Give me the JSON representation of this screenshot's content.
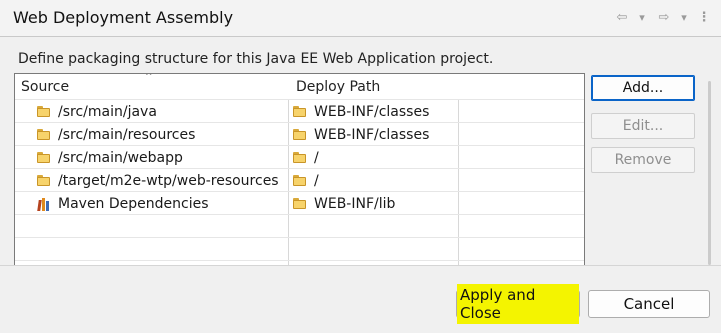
{
  "header": {
    "title": "Web Deployment Assembly",
    "nav": [
      {
        "name": "back-arrow-icon",
        "glyph": "⇦"
      },
      {
        "name": "back-dropdown-icon",
        "glyph": "▾"
      },
      {
        "name": "forward-arrow-icon",
        "glyph": "⇨"
      },
      {
        "name": "forward-dropdown-icon",
        "glyph": "▾"
      },
      {
        "name": "more-options-icon",
        "glyph": "⋮"
      }
    ]
  },
  "main": {
    "description": "Define packaging structure for this Java EE Web Application project.",
    "table": {
      "columns": [
        "Source",
        "Deploy Path"
      ],
      "rows": [
        {
          "source": "/src/main/java",
          "deploy": "WEB-INF/classes",
          "icon": "folder-icon"
        },
        {
          "source": "/src/main/resources",
          "deploy": "WEB-INF/classes",
          "icon": "folder-icon"
        },
        {
          "source": "/src/main/webapp",
          "deploy": "/",
          "icon": "folder-icon"
        },
        {
          "source": "/target/m2e-wtp/web-resources",
          "deploy": "/",
          "icon": "folder-icon"
        },
        {
          "source": "Maven Dependencies",
          "deploy": "WEB-INF/lib",
          "icon": "maven-library-icon"
        }
      ]
    },
    "buttons": {
      "add": "Add...",
      "edit": "Edit...",
      "remove": "Remove"
    }
  },
  "footer": {
    "apply_close": "Apply and Close",
    "cancel": "Cancel"
  },
  "colors": {
    "highlight": "#f4f400",
    "default_button_border": "#0a64c8"
  }
}
